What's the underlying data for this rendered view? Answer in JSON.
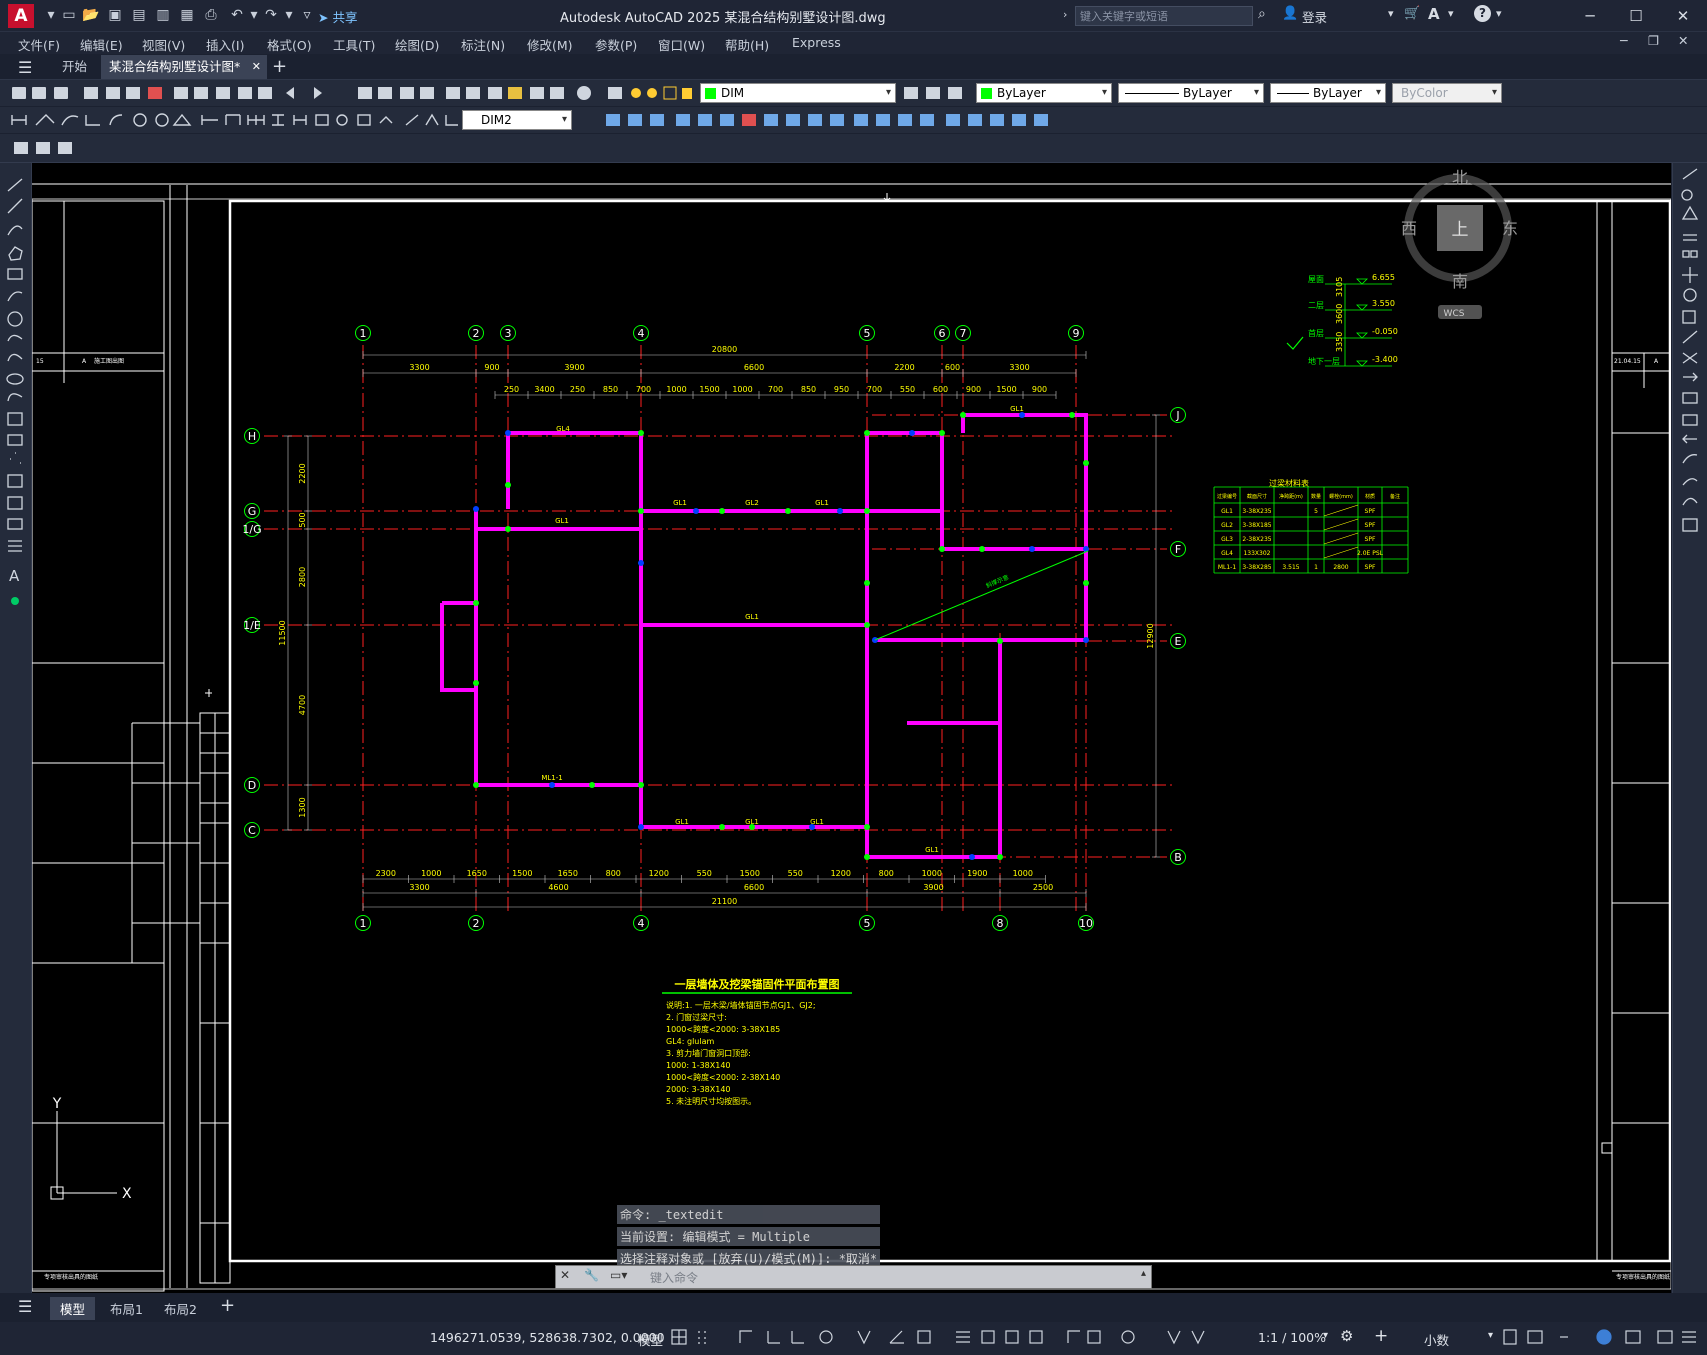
{
  "app": {
    "title": "Autodesk AutoCAD 2025    某混合结构别墅设计图.dwg",
    "logo": "A",
    "search_placeholder": "键入关键字或短语",
    "share_label": "共享",
    "login_label": "登录"
  },
  "menu": [
    "文件(F)",
    "编辑(E)",
    "视图(V)",
    "插入(I)",
    "格式(O)",
    "工具(T)",
    "绘图(D)",
    "标注(N)",
    "修改(M)",
    "参数(P)",
    "窗口(W)",
    "帮助(H)",
    "Express"
  ],
  "tabs": {
    "start": "开始",
    "active": "某混合结构别墅设计图*"
  },
  "toolbar": {
    "layer": "DIM",
    "color": "ByLayer",
    "linetype": "ByLayer",
    "lineweight": "ByLayer",
    "plotstyle": "ByColor",
    "dimstyle": "DIM2"
  },
  "viewcube": {
    "north": "北",
    "south": "南",
    "east": "东",
    "west": "西",
    "top": "上",
    "wcs": "WCS"
  },
  "drawing": {
    "title": "一层墙体及挖梁锚固件平面布置图",
    "overall_width_top": "20800",
    "overall_width_bottom": "21100",
    "overall_height": "11500",
    "right_height": "12900",
    "axes_top": [
      "1",
      "2",
      "3",
      "4",
      "5",
      "6",
      "7",
      "9"
    ],
    "axes_bottom": [
      "1",
      "2",
      "4",
      "5",
      "8",
      "10"
    ],
    "axes_left": [
      "H",
      "G",
      "1/G",
      "1/E",
      "D",
      "C"
    ],
    "axes_right": [
      "J",
      "F",
      "E",
      "B"
    ],
    "dims_top1": [
      "3300",
      "900",
      "3900",
      "6600",
      "2200",
      "600",
      "3300"
    ],
    "dims_top2": [
      "250",
      "3400",
      "250",
      "850",
      "700",
      "1000",
      "1500",
      "1000",
      "700",
      "850",
      "950",
      "700",
      "550",
      "600",
      "900",
      "1500",
      "900"
    ],
    "dims_bottom1": [
      "2300",
      "1000",
      "1650",
      "1500",
      "1650",
      "800",
      "1200",
      "550",
      "1500",
      "550",
      "1200",
      "800",
      "1000",
      "1900",
      "1000"
    ],
    "dims_bottom2": [
      "3300",
      "4600",
      "6600",
      "3900",
      "2500"
    ],
    "left_dims": [
      "2200",
      "500",
      "2800",
      "4700",
      "1300"
    ],
    "elevations": [
      {
        "label": "屋面",
        "value": "6.655"
      },
      {
        "label": "二层",
        "value": "3.550"
      },
      {
        "label": "首层",
        "value": "-0.050"
      },
      {
        "label": "地下一层",
        "value": "-3.400"
      }
    ],
    "elev_dims": [
      "3105",
      "3600",
      "3350"
    ],
    "table_title": "过梁材料表",
    "table_headers": [
      "过梁编号",
      "截面尺寸",
      "净跨距(m)",
      "数量",
      "螺栓(mm)",
      "材质",
      "备注"
    ],
    "table_rows": [
      [
        "GL1",
        "3-38X235",
        "",
        "5",
        "",
        "SPF",
        ""
      ],
      [
        "GL2",
        "3-38X185",
        "",
        "",
        "",
        "SPF",
        ""
      ],
      [
        "GL3",
        "2-38X235",
        "",
        "",
        "",
        "SPF",
        ""
      ],
      [
        "GL4",
        "133X302",
        "",
        "",
        "",
        "2.0E PSL",
        ""
      ],
      [
        "ML1-1",
        "3-38X285",
        "3.515",
        "1",
        "2800",
        "SPF",
        ""
      ]
    ],
    "notes": [
      "说明:1. 一层木梁/墙体锚固节点GJ1、GJ2;",
      "2. 门窗过梁尺寸:",
      "1000<跨度<2000: 3-38X185",
      "GL4: glulam",
      "3. 剪力墙门窗洞口顶部:",
      "1000: 1-38X140",
      "1000<跨度<2000: 2-38X140",
      "2000: 3-38X140",
      "5. 未注明尺寸均按图示。"
    ],
    "beam_labels": [
      "GL4",
      "GL1",
      "GL2",
      "GL1",
      "GL1",
      "GL1",
      "ML1-1",
      "GL1",
      "GL1",
      "GL1",
      "GL1",
      "GL1"
    ]
  },
  "command": {
    "history": [
      "命令: _textedit",
      "当前设置: 编辑模式 = Multiple",
      "选择注释对象或 [放弃(U)/模式(M)]: *取消*"
    ],
    "placeholder": "键入命令"
  },
  "layout_tabs": [
    "模型",
    "布局1",
    "布局2"
  ],
  "status": {
    "coords": "1496271.0539, 528638.7302, 0.0000",
    "model": "模型",
    "scale": "1:1 / 100%",
    "units": "小数"
  },
  "colors": {
    "accent": "#0696d7",
    "wall": "#ff00ff",
    "axis": "#ff0000",
    "dim": "#ffff00",
    "green": "#00ff00"
  }
}
